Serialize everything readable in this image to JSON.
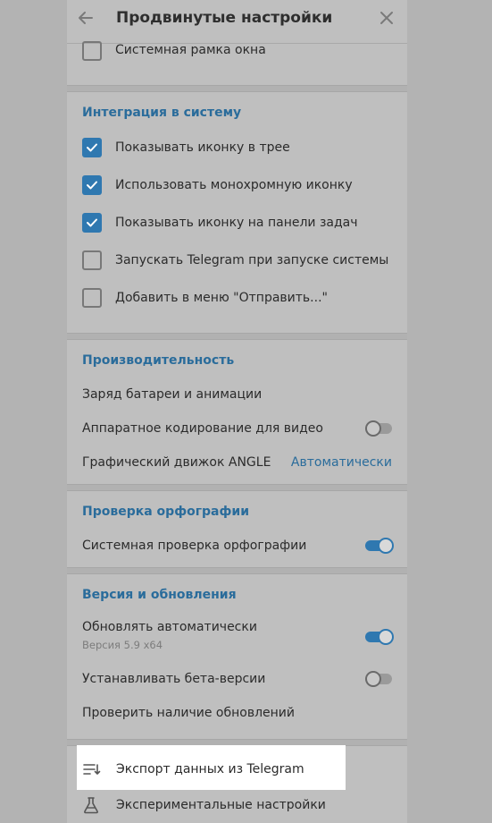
{
  "header": {
    "title": "Продвинутые настройки"
  },
  "window_frame": {
    "label": "Системная рамка окна",
    "checked": false
  },
  "integration": {
    "title": "Интеграция в систему",
    "items": [
      {
        "label": "Показывать иконку в трее",
        "checked": true
      },
      {
        "label": "Использовать монохромную иконку",
        "checked": true
      },
      {
        "label": "Показывать иконку на панели задач",
        "checked": true
      },
      {
        "label": "Запускать Telegram при запуске системы",
        "checked": false
      },
      {
        "label": "Добавить в меню \"Отправить...\"",
        "checked": false
      }
    ]
  },
  "performance": {
    "title": "Производительность",
    "battery_label": "Заряд батареи и анимации",
    "hw_label": "Аппаратное кодирование для видео",
    "hw_enabled": false,
    "angle_label": "Графический движок ANGLE",
    "angle_value": "Автоматически"
  },
  "spellcheck": {
    "title": "Проверка орфографии",
    "system_label": "Системная проверка орфографии",
    "system_enabled": true
  },
  "updates": {
    "title": "Версия и обновления",
    "auto_label": "Обновлять автоматически",
    "version_label": "Версия 5.9 x64",
    "auto_enabled": true,
    "beta_label": "Устанавливать бета-версии",
    "beta_enabled": false,
    "check_label": "Проверить наличие обновлений"
  },
  "bottom": {
    "export_label": "Экспорт данных из Telegram",
    "experimental_label": "Экспериментальные настройки"
  },
  "colors": {
    "accent": "#2f78b0",
    "link": "#2a6c9b",
    "highlight": "#ffffff"
  }
}
